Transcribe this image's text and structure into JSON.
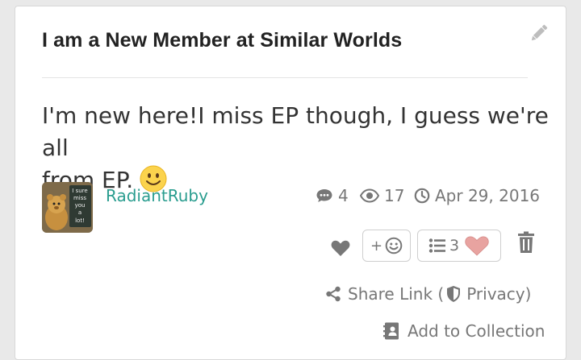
{
  "post": {
    "title": "I am a New Member at Similar Worlds",
    "body_line1": "I'm new here!I miss EP though, I guess we're all",
    "body_line2": "from EP."
  },
  "author": {
    "name": "RadiantRuby",
    "avatar_caption": [
      "I sure",
      "miss",
      "you",
      "a",
      "lot!"
    ]
  },
  "stats": {
    "comments": "4",
    "views": "17",
    "date": "Apr 29, 2016"
  },
  "actions": {
    "emoji_plus": "+",
    "reactions_count": "3",
    "share_label": "Share Link (",
    "privacy_label": "Privacy)",
    "collection_label": "Add to Collection"
  },
  "colors": {
    "author": "#2a9d8f",
    "icon_gray": "#777777",
    "heart_pink": "#e8a3a0"
  }
}
